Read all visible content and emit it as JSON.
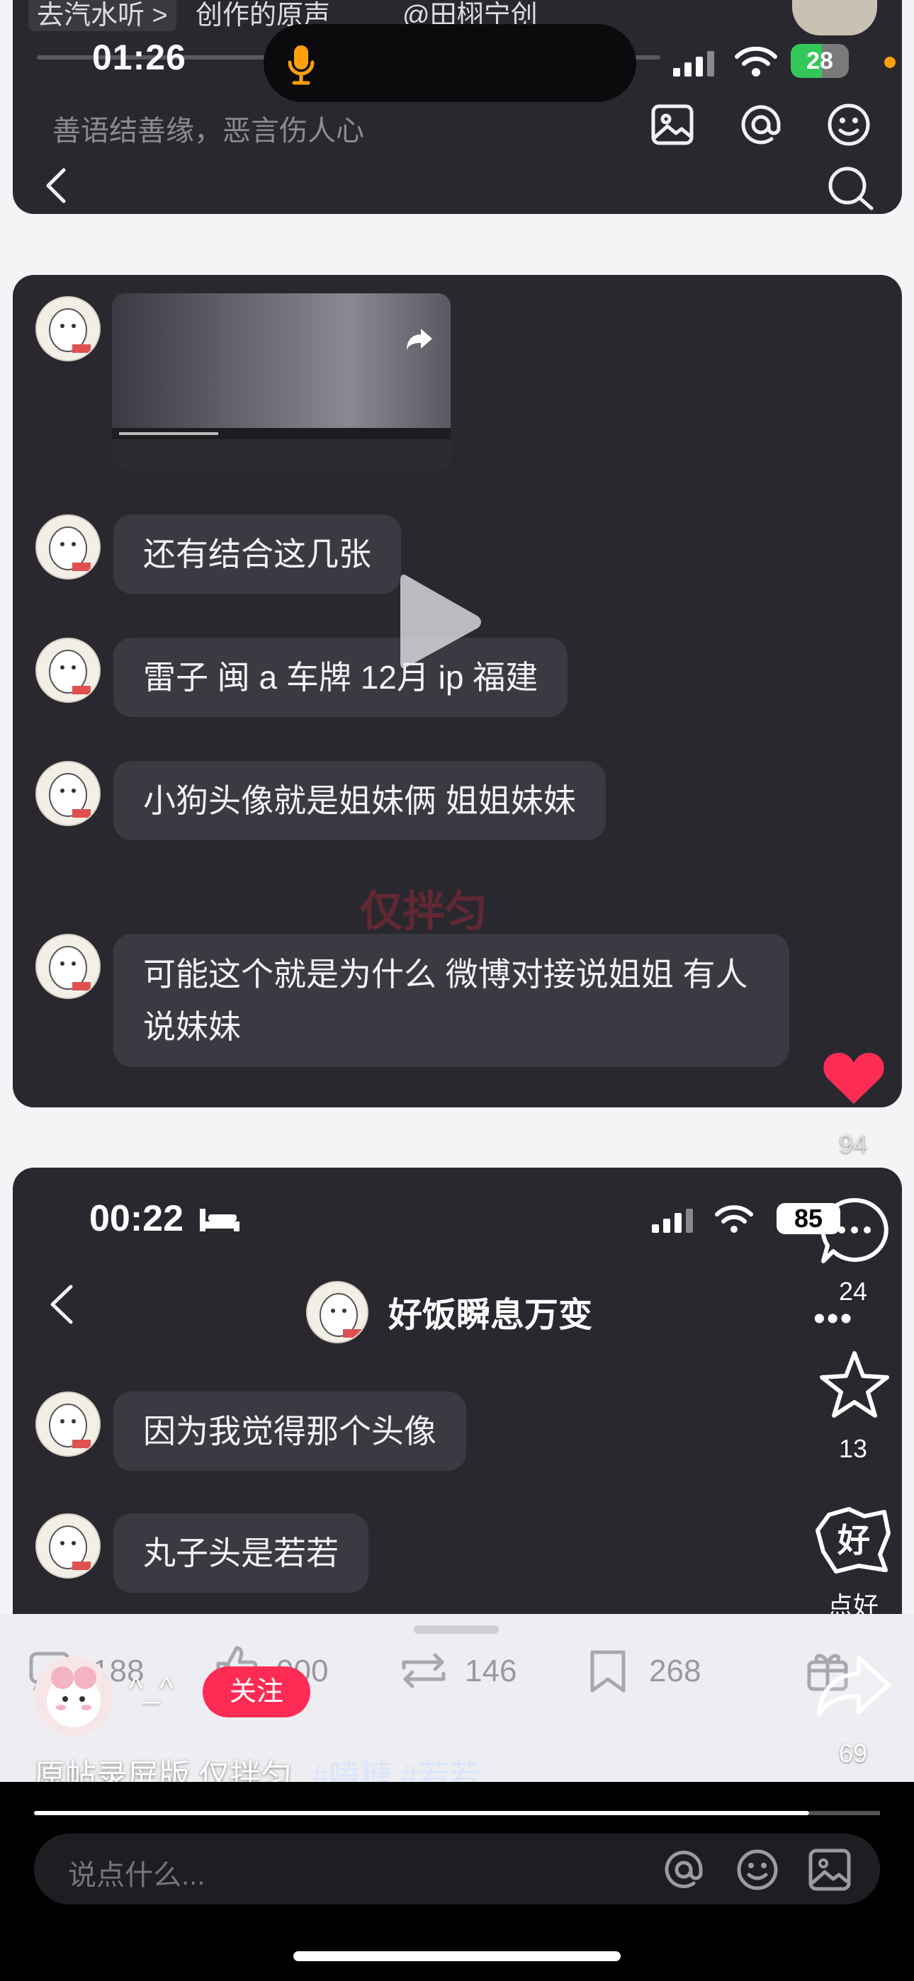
{
  "status_bar": {
    "time": "01:26",
    "battery": "28"
  },
  "top_card": {
    "strip_left": "去汽水听 >",
    "strip_mid": "创作的原声",
    "strip_right": "@田栩宁创",
    "input_placeholder": "善语结善缘，恶言伤人心"
  },
  "chat": {
    "messages": [
      {
        "text": "还有结合这几张"
      },
      {
        "text": "雷子 闽 a 车牌 12月 ip 福建"
      },
      {
        "text": "小狗头像就是姐妹俩 姐姐妹妹"
      },
      {
        "text": "可能这个就是为什么 微博对接说姐姐 有人说妹妹"
      }
    ],
    "watermark": "仅拌匀"
  },
  "dm_screenshot": {
    "time": "00:22",
    "battery": "85",
    "title": "好饭瞬息万变",
    "messages": [
      {
        "text": "因为我觉得那个头像"
      },
      {
        "text": "丸子头是若若"
      }
    ]
  },
  "rail": {
    "like_count": "94",
    "comment_count": "24",
    "favorite_count": "13",
    "good_label": "点好",
    "share_count": "69"
  },
  "post_stats": {
    "comments": "188",
    "likes": "900",
    "reposts": "146",
    "saves": "268"
  },
  "author": {
    "name": "^_^",
    "follow_label": "关注"
  },
  "caption": {
    "text": "原帖录屏版 仅拌匀",
    "tags": "#嗑糖 #若若"
  },
  "comment_input": {
    "placeholder": "说点什么..."
  }
}
